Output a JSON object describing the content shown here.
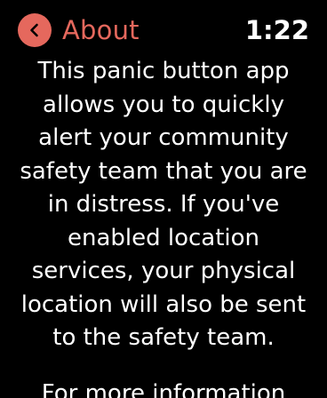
{
  "header": {
    "back_label": "About",
    "time": "1:22",
    "back_icon": "chevron-left-icon"
  },
  "content": {
    "description": "This panic button app\nallows you to quickly\nalert your community\nsafety team that you are\nin distress.  If you've\nenabled location\nservices, your physical\nlocation will also be sent\nto the safety team.",
    "more_info": "For more information"
  },
  "colors": {
    "accent": "#e5685d",
    "background": "#000000",
    "text": "#ffffff"
  }
}
